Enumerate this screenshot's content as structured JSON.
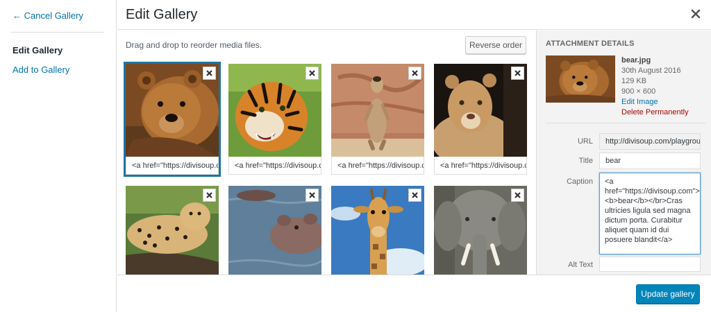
{
  "menu": {
    "cancel": "← Cancel Gallery",
    "active_item": "Edit Gallery",
    "add_item": "Add to Gallery"
  },
  "header": {
    "title": "Edit Gallery"
  },
  "content": {
    "instruction": "Drag and drop to reorder media files.",
    "reverse_label": "Reverse order",
    "items": [
      {
        "animal": "bear",
        "caption": "<a href=\"https://divisoup.c"
      },
      {
        "animal": "tiger",
        "caption": "<a href=\"https://divisoup.c"
      },
      {
        "animal": "meerkat",
        "caption": "<a href=\"https://divisoup.c"
      },
      {
        "animal": "lioness",
        "caption": "<a href=\"https://divisoup.c"
      },
      {
        "animal": "leopard",
        "caption": ""
      },
      {
        "animal": "hippo",
        "caption": ""
      },
      {
        "animal": "giraffe",
        "caption": ""
      },
      {
        "animal": "elephant",
        "caption": ""
      }
    ]
  },
  "sidebar": {
    "heading": "Attachment Details",
    "filename": "bear.jpg",
    "date": "30th August 2016",
    "size": "129 KB",
    "dimensions": "900 × 600",
    "edit_link": "Edit Image",
    "delete_link": "Delete Permanently",
    "url_label": "URL",
    "url_value": "http://divisoup.com/playground/",
    "title_label": "Title",
    "title_value": "bear",
    "caption_label": "Caption",
    "caption_value": "<a href=\"https://divisoup.com\"><b>bear</b></br>Cras ultricies ligula sed magna dictum porta. Curabitur aliquet quam id dui posuere blandit</a>",
    "alt_label": "Alt Text",
    "alt_value": ""
  },
  "footer": {
    "update_label": "Update gallery"
  },
  "colors": {
    "primary": "#0085ba",
    "link": "#0073aa",
    "danger": "#a00",
    "selected": "#1e73a1"
  }
}
